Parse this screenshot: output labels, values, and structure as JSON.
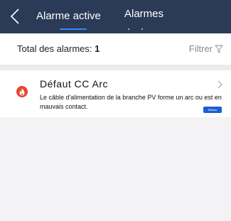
{
  "header": {
    "tabs": [
      {
        "label": "Alarme active",
        "active": true
      },
      {
        "label": "Alarmes",
        "active": false
      }
    ],
    "background_color": "#2b3a56",
    "accent_color": "#2d8cff"
  },
  "summary": {
    "total_label": "Total des alarmes:",
    "total_count": "1",
    "filter_label": "Filtrer"
  },
  "alarms": [
    {
      "title": "Défaut CC Arc",
      "description": "Le câble d'alimentation de la branche PV forme un arc ou est en mauvais contact.",
      "severity_color": "#e8452f",
      "icon": "flame-icon",
      "action_label": "Effacer"
    }
  ]
}
